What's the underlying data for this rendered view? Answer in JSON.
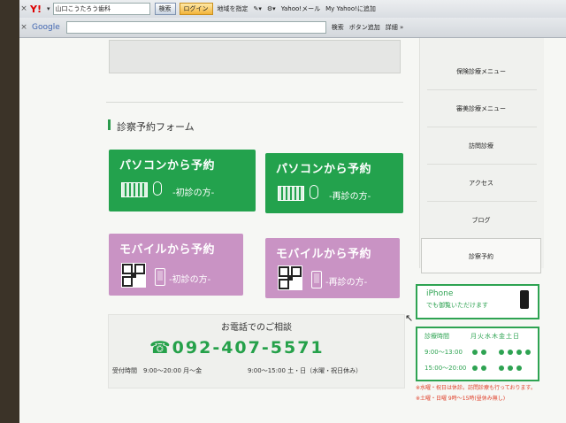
{
  "toolbar1": {
    "close": "×",
    "yahoo_logo": "Y!",
    "search_value": "山口こうたろう歯科",
    "search_button": "検索",
    "login": "ログイン",
    "region": "地域を指定",
    "mail": "Yahoo!メール",
    "myyahoo": "My Yahoo!に追加"
  },
  "toolbar2": {
    "close": "×",
    "google_logo": "Google",
    "search_button": "検索",
    "add_button": "ボタン追加",
    "details": "詳細 »"
  },
  "section": {
    "title": "診察予約フォーム"
  },
  "cards": [
    {
      "main": "パソコンから予約",
      "sub": "-初診の方-",
      "color": "#23a24d"
    },
    {
      "main": "パソコンから予約",
      "sub": "-再診の方-",
      "color": "#23a24d"
    },
    {
      "main": "モバイルから予約",
      "sub": "-初診の方-",
      "color": "#c993c4"
    },
    {
      "main": "モバイルから予約",
      "sub": "-再診の方-",
      "color": "#c993c4"
    }
  ],
  "contact": {
    "title": "お電話でのご相談",
    "tel": "☎092-407-5571",
    "hours1": "受付時間　9:00～20:00 月～金",
    "hours2": "9:00～15:00 土・日（水曜・祝日休み）"
  },
  "sidebar": {
    "items": [
      "保険診療メニュー",
      "審美診療メニュー",
      "訪問診療",
      "アクセス",
      "ブログ",
      "診察予約"
    ]
  },
  "iphone": {
    "title": "iPhone",
    "sub": "でも御覧いただけます"
  },
  "hours_box": {
    "title": "診療時間",
    "days": "月火水木金土日",
    "row1": "9:00～13:00",
    "row2": "15:00～20:00"
  },
  "notes": [
    "※水曜・祝日は休診。訪問診療も行っております。",
    "※土曜・日曜 9時～15時(昼休み無し)"
  ]
}
